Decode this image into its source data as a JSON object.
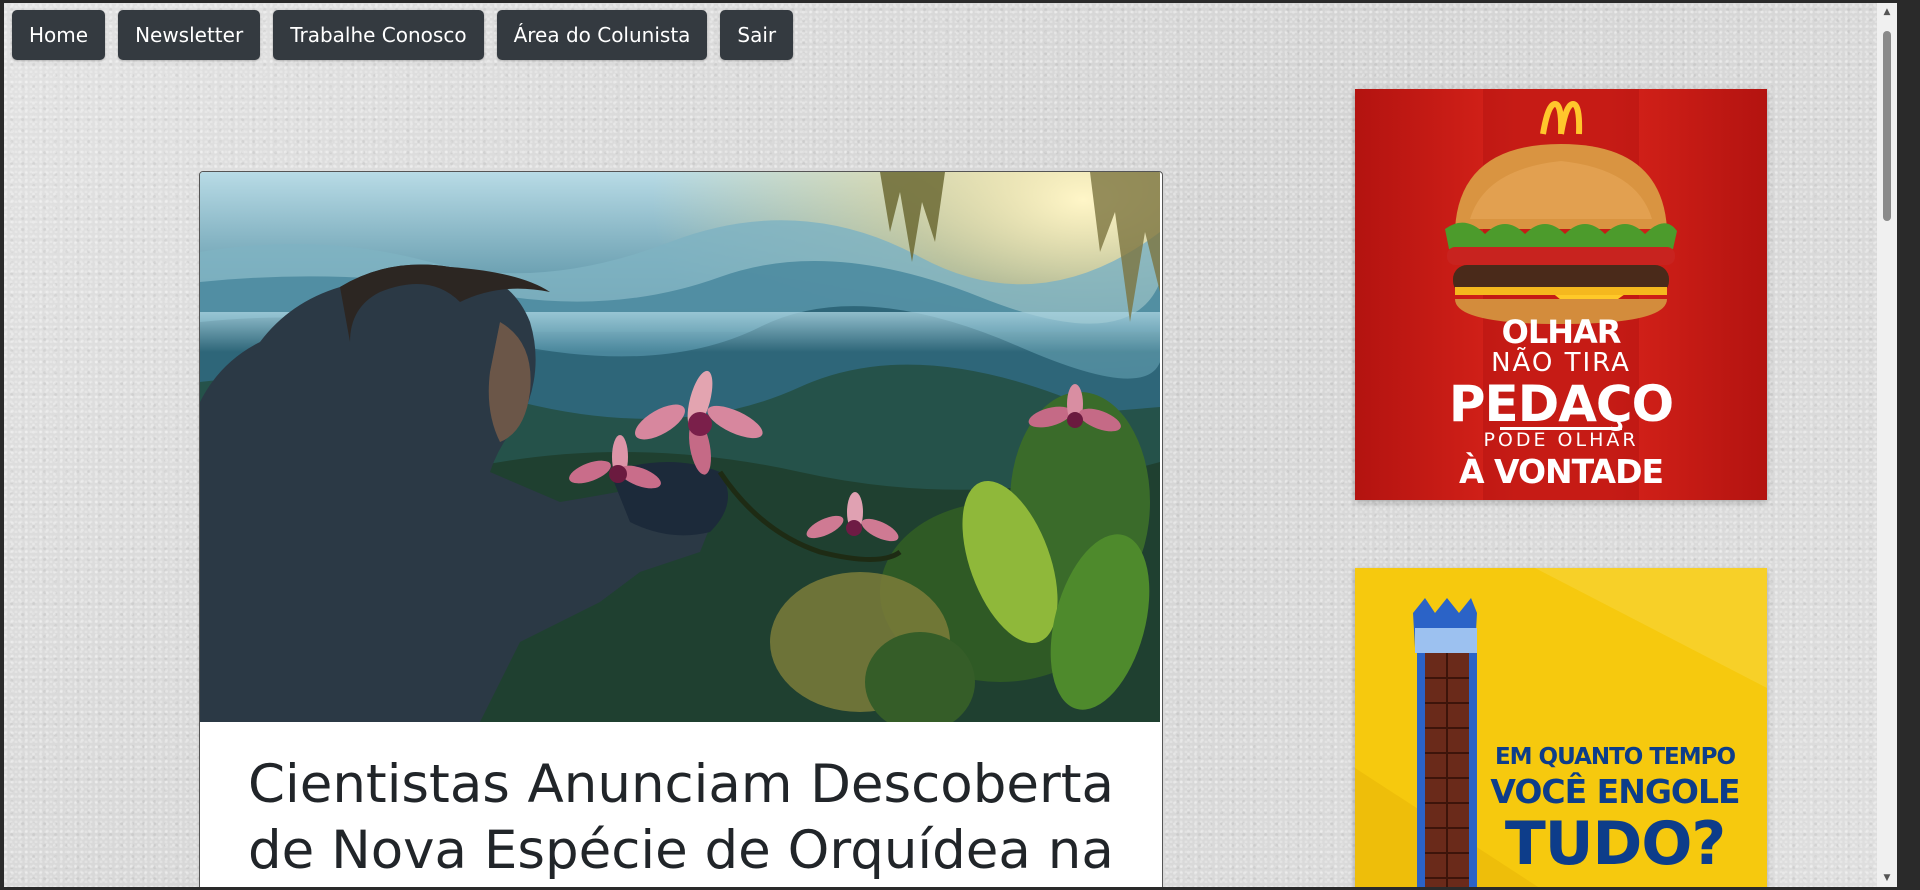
{
  "nav": {
    "items": [
      {
        "label": "Home"
      },
      {
        "label": "Newsletter"
      },
      {
        "label": "Trabalhe Conosco"
      },
      {
        "label": "Área do Colunista"
      },
      {
        "label": "Sair"
      }
    ]
  },
  "article": {
    "title": "Cientistas Anunciam Descoberta de Nova Espécie de Orquídea na"
  },
  "ads": {
    "mcdonalds": {
      "line1": "OLHAR",
      "line2": "NÃO TIRA",
      "line3": "PEDAÇO",
      "line4": "PODE OLHAR",
      "line5": "À VONTADE"
    },
    "biscuit": {
      "line1": "EM QUANTO TEMPO",
      "line2": "VOCÊ ENGOLE",
      "line3": "TUDO?"
    }
  },
  "colors": {
    "nav_button_bg": "#343a40",
    "mcd_red": "#d8231a",
    "mcd_yellow": "#ffc72c",
    "bis_yellow": "#f6c90e",
    "bis_blue": "#0d3d8a"
  }
}
